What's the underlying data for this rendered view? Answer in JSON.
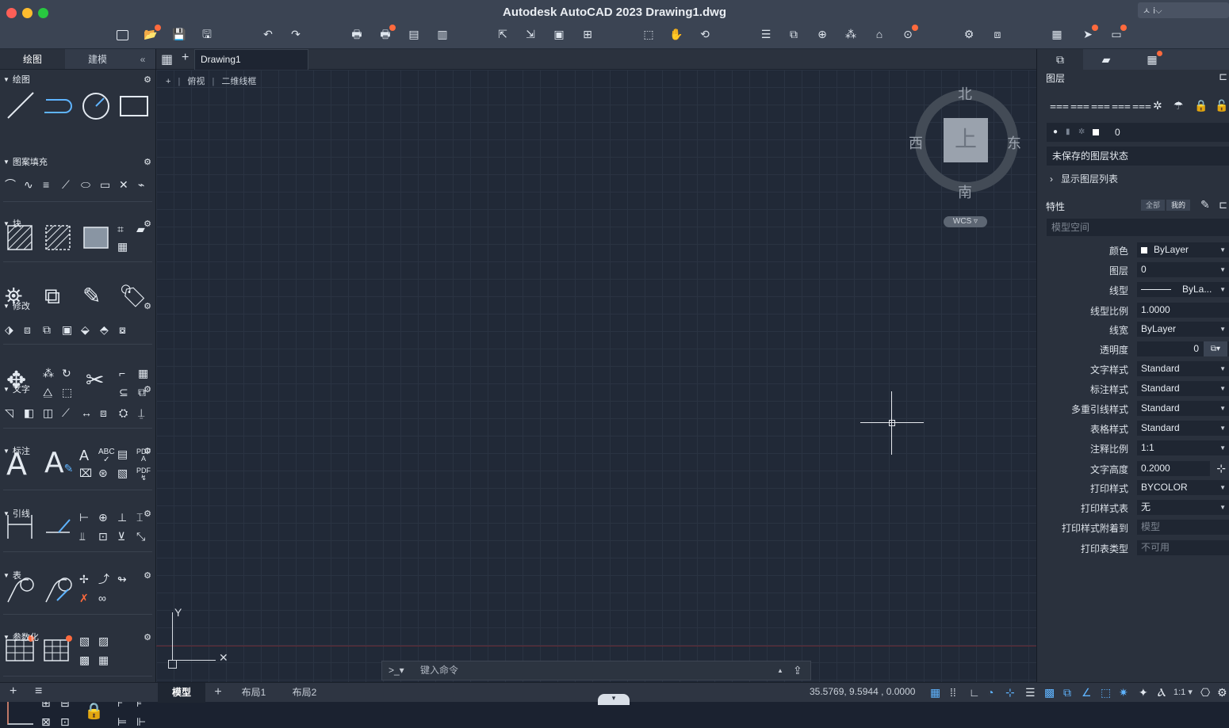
{
  "window": {
    "title": "Autodesk AutoCAD 2023    Drawing1.dwg",
    "user_label": "ㅅ ⅰ⌵"
  },
  "left_panel": {
    "tabs": [
      "绘图",
      "建模"
    ],
    "collapse": "«",
    "sections": [
      "绘图",
      "图案填充",
      "块",
      "修改",
      "文字",
      "标注",
      "引线",
      "表",
      "参数化"
    ]
  },
  "doc_tabs": {
    "active": "Drawing1",
    "new_tab": "+",
    "grid_icon": "▦"
  },
  "viewport": {
    "plus": "+",
    "view": "俯视",
    "visual_style": "二维线框"
  },
  "viewcube": {
    "north": "北",
    "south": "南",
    "east": "东",
    "west": "西",
    "top": "上",
    "wcs": "WCS ▿"
  },
  "ucs": {
    "x_label": "✕",
    "y_label": "Y"
  },
  "command_line": {
    "prompt": ">_▾",
    "placeholder": "键入命令",
    "up": "▲",
    "share": "⇪"
  },
  "right_panel": {
    "layers_title": "图层",
    "current_layer": "0",
    "layer_state": "未保存的图层状态",
    "show_layer_list": "显示图层列表",
    "properties_title": "特性",
    "filter_all": "全部",
    "filter_mine": "我的",
    "space": "模型空间",
    "properties": [
      {
        "name": "颜色",
        "value": "ByLayer"
      },
      {
        "name": "图层",
        "value": "0"
      },
      {
        "name": "线型",
        "value": "ByLa..."
      },
      {
        "name": "线型比例",
        "value": "1.0000"
      },
      {
        "name": "线宽",
        "value": "ByLayer"
      },
      {
        "name": "透明度",
        "value": "0"
      },
      {
        "name": "文字样式",
        "value": "Standard"
      },
      {
        "name": "标注样式",
        "value": "Standard"
      },
      {
        "name": "多重引线样式",
        "value": "Standard"
      },
      {
        "name": "表格样式",
        "value": "Standard"
      },
      {
        "name": "注释比例",
        "value": "1:1"
      },
      {
        "name": "文字高度",
        "value": "0.2000"
      },
      {
        "name": "打印样式",
        "value": "BYCOLOR"
      },
      {
        "name": "打印样式表",
        "value": "无"
      },
      {
        "name": "打印样式附着到",
        "value": "模型"
      },
      {
        "name": "打印表类型",
        "value": "不可用"
      }
    ]
  },
  "status_bar": {
    "tabs": [
      "模型",
      "布局1",
      "布局2"
    ],
    "add": "+",
    "coordinates": "35.5769, 9.5944 , 0.0000",
    "scale": "1:1 ▾"
  },
  "colors": {
    "accent_dot": "#ff6a3d",
    "toggle_on": "#5fb4ff",
    "canvas": "#212937"
  }
}
